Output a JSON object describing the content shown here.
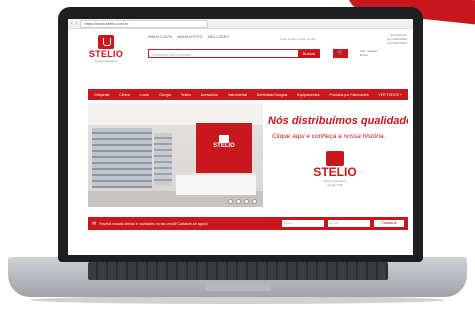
{
  "browser": {
    "url": "https://www.stelio.com.br"
  },
  "header": {
    "logo_name": "STELIO",
    "logo_tagline": "Artigos Dentários",
    "top_links": [
      "MINHA CONTA",
      "MINHA ARTIFIO",
      "MEU CARRO"
    ],
    "promo": "Frete Grátis a partir de R$...",
    "contact": [
      "Atendimento",
      "(xx) 0000-0000",
      "(xx) 0000-0000"
    ],
    "search_placeholder": "Encontre seu produto",
    "search_button": "Buscar",
    "cart_icon": "cart-icon",
    "account": [
      "Olá, visitante",
      "Entrar"
    ]
  },
  "menu": [
    "Ortopedia",
    "Clínica",
    "Luvas",
    "Cirurgia",
    "Testes",
    "Acessórios",
    "Instrumental",
    "Dentística/Cirúrgica",
    "Equipamentos",
    "Produtos por Fabricantes",
    "VER TODOS +"
  ],
  "banner": {
    "tagline_main": "Nós distribuímos qualidade!",
    "tagline_sub": "Clique aqui e conheça a nossa história.",
    "logo_name": "STELIO",
    "logo_tagline": "Artigos Dentários",
    "logo_since": "desde 1975",
    "wall_logo": "STELIO"
  },
  "newsletter": {
    "text": "Receba nossas ofertas e novidades no seu email! Cadastre-se agora!",
    "name_placeholder": "Nome",
    "email_placeholder": "E-mail",
    "button": "Cadastrar"
  },
  "colors": {
    "brand_red": "#c8171d"
  }
}
